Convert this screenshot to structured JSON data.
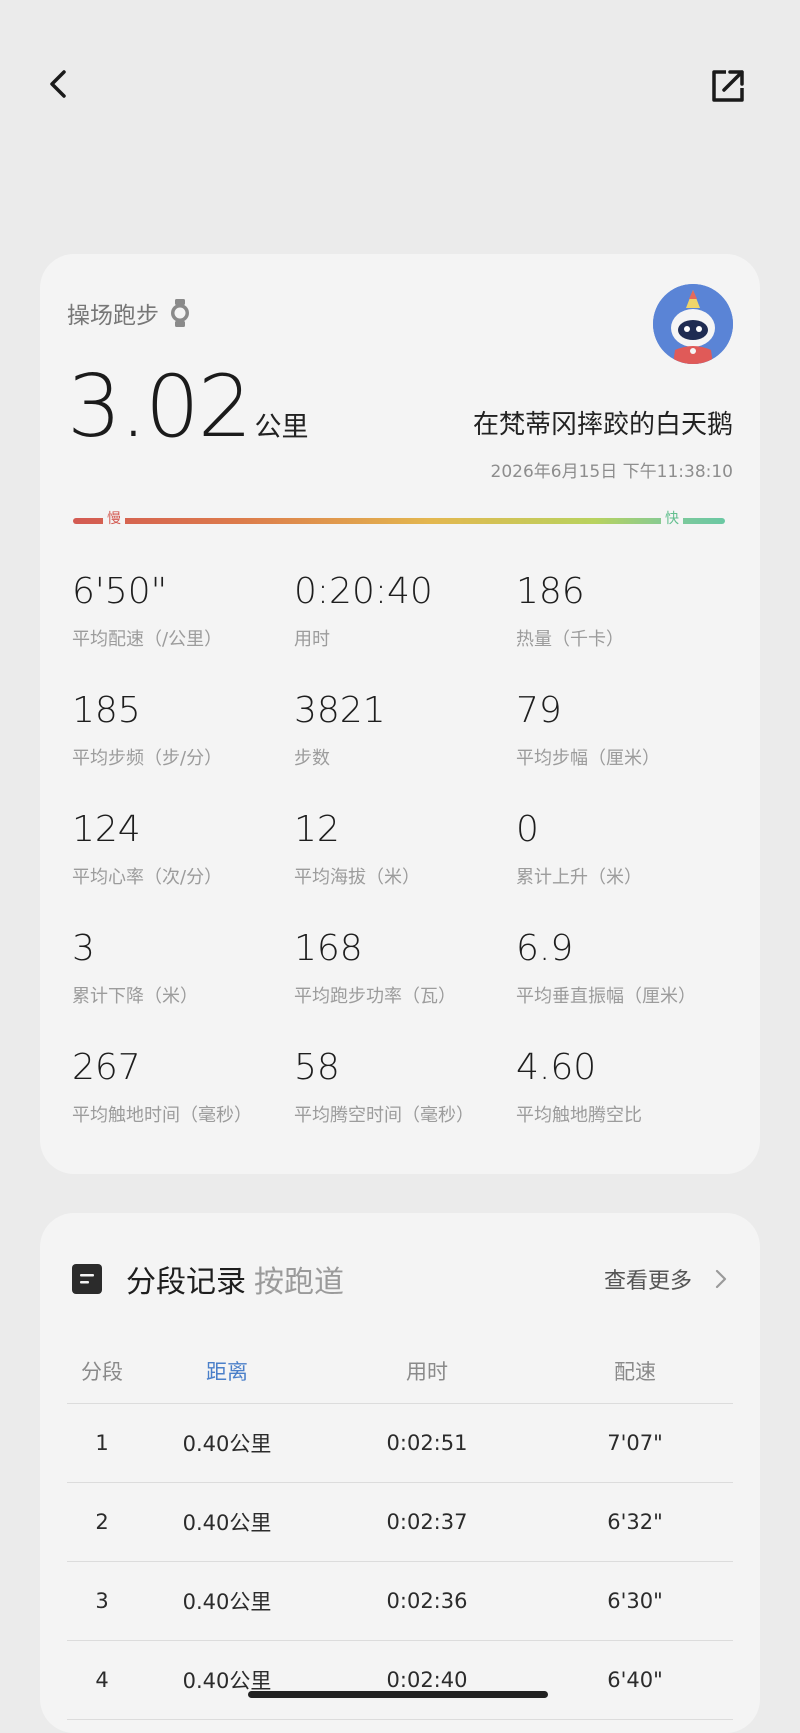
{
  "header": {
    "back_icon": "chevron-left-icon",
    "share_icon": "share-external-icon"
  },
  "summary": {
    "sport_type": "操场跑步",
    "device_icon": "watch-icon",
    "distance_value": "3.02",
    "distance_unit": "公里",
    "username": "在梵蒂冈摔跤的白天鹅",
    "datetime": "2026年6月15日 下午11:38:10",
    "pace_slow_label": "慢",
    "pace_fast_label": "快",
    "stats": [
      {
        "value": "6'50\"",
        "label": "平均配速（/公里）"
      },
      {
        "value": "0:20:40",
        "label": "用时"
      },
      {
        "value": "186",
        "label": "热量（千卡）"
      },
      {
        "value": "185",
        "label": "平均步频（步/分）"
      },
      {
        "value": "3821",
        "label": "步数"
      },
      {
        "value": "79",
        "label": "平均步幅（厘米）"
      },
      {
        "value": "124",
        "label": "平均心率（次/分）"
      },
      {
        "value": "12",
        "label": "平均海拔（米）"
      },
      {
        "value": "0",
        "label": "累计上升（米）"
      },
      {
        "value": "3",
        "label": "累计下降（米）"
      },
      {
        "value": "168",
        "label": "平均跑步功率（瓦）"
      },
      {
        "value": "6.9",
        "label": "平均垂直振幅（厘米）"
      },
      {
        "value": "267",
        "label": "平均触地时间（毫秒）"
      },
      {
        "value": "58",
        "label": "平均腾空时间（毫秒）"
      },
      {
        "value": "4.60",
        "label": "平均触地腾空比"
      }
    ]
  },
  "splits": {
    "icon": "list-icon",
    "title": "分段记录",
    "mode": "按跑道",
    "view_more": "查看更多",
    "columns": [
      "分段",
      "距离",
      "用时",
      "配速"
    ],
    "rows": [
      [
        "1",
        "0.40公里",
        "0:02:51",
        "7'07\""
      ],
      [
        "2",
        "0.40公里",
        "0:02:37",
        "6'32\""
      ],
      [
        "3",
        "0.40公里",
        "0:02:36",
        "6'30\""
      ],
      [
        "4",
        "0.40公里",
        "0:02:40",
        "6'40\""
      ]
    ]
  }
}
